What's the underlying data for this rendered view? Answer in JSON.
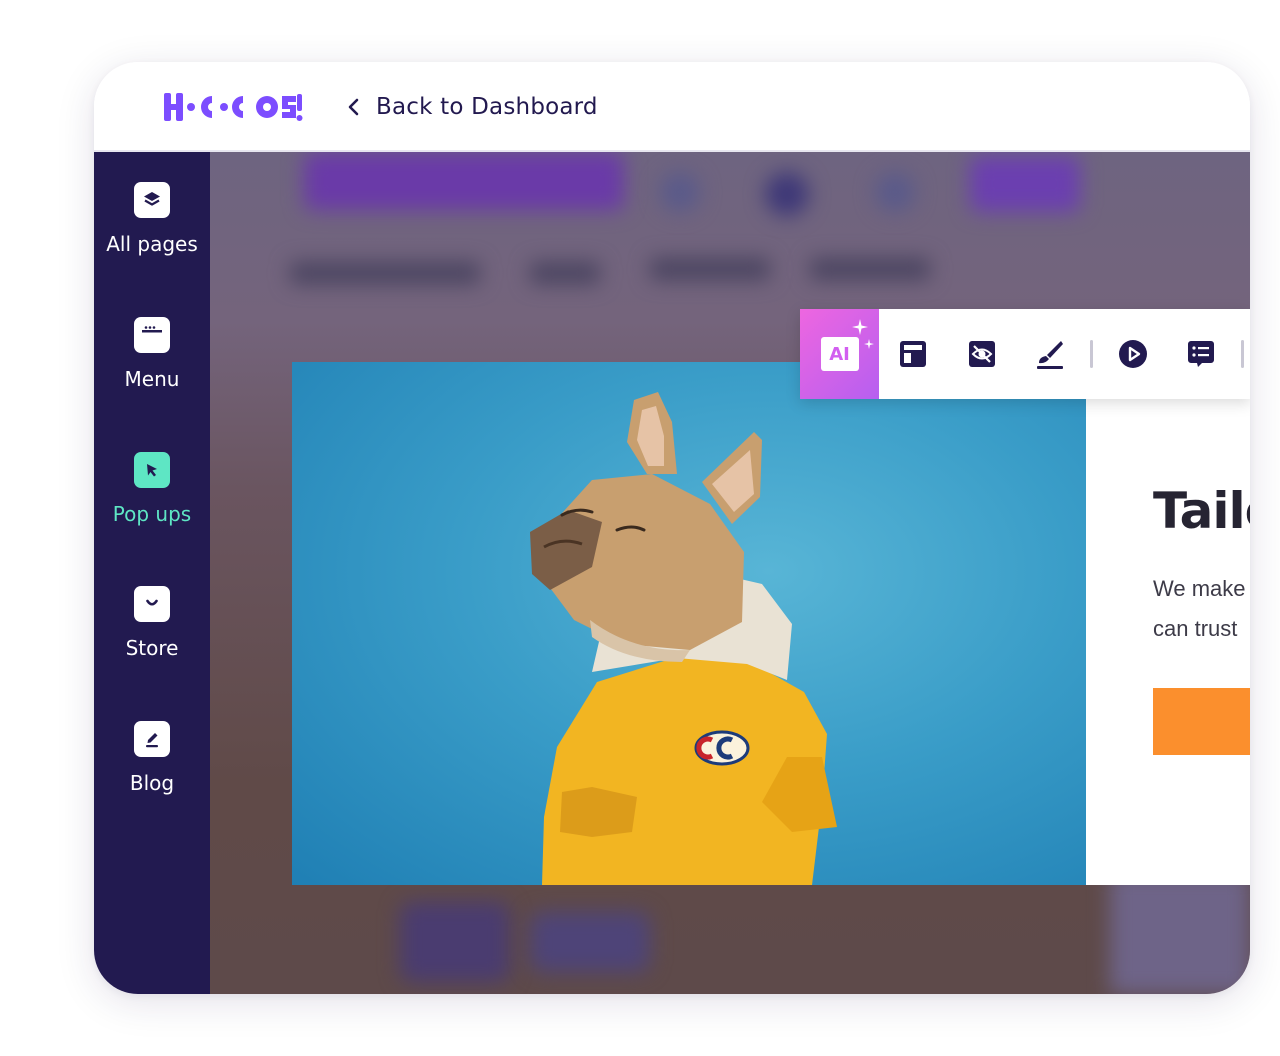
{
  "app": {
    "logo_text": "HOCOOS",
    "back_link": "Back to Dashboard"
  },
  "sidebar": {
    "items": [
      {
        "label": "All pages",
        "icon": "layers-icon",
        "active": false
      },
      {
        "label": "Menu",
        "icon": "menu-window-icon",
        "active": false
      },
      {
        "label": "Pop ups",
        "icon": "cursor-popup-icon",
        "active": true
      },
      {
        "label": "Store",
        "icon": "shopping-bag-icon",
        "active": false
      },
      {
        "label": "Blog",
        "icon": "edit-note-icon",
        "active": false
      }
    ]
  },
  "toolbar": {
    "ai_label": "AI",
    "tools": [
      "layout-icon",
      "hide-icon",
      "brush-icon",
      "play-icon",
      "list-chat-icon"
    ]
  },
  "content": {
    "headline": "Taile",
    "body_lines": [
      "We make",
      "can trust"
    ]
  },
  "colors": {
    "sidebar_bg": "#221a50",
    "accent_active": "#5ee6c4",
    "brand_purple": "#7c4dff",
    "ai_gradient_start": "#ee66e0",
    "ai_gradient_end": "#b65ff0",
    "cta_orange": "#fb8f2d",
    "photo_blue": "#3a9dc8"
  }
}
